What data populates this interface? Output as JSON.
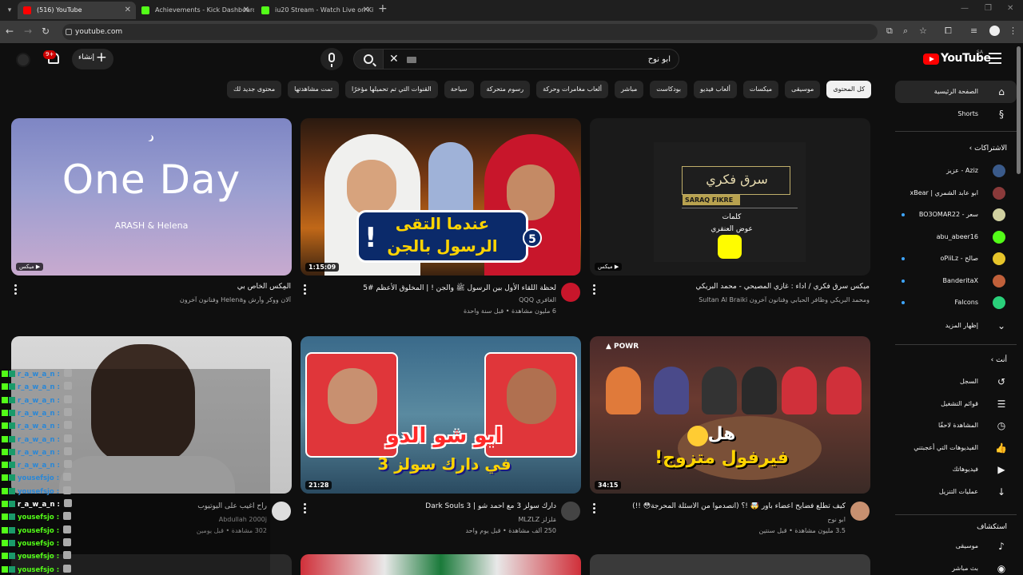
{
  "browser": {
    "tabs": [
      {
        "title": "(516) YouTube",
        "active": true,
        "favicon": "youtube-icon"
      },
      {
        "title": "Achievements - Kick Dashboard",
        "active": false,
        "favicon": "kick-icon"
      },
      {
        "title": "iu20 Stream - Watch Live on Ki",
        "active": false,
        "favicon": "kick-icon"
      }
    ],
    "url": "youtube.com"
  },
  "header": {
    "logo_text": "YouTube",
    "logo_country": "SA",
    "search_query": "ابو نوح",
    "create_label": "إنشاء",
    "notification_count": "9+"
  },
  "chips": [
    "كل المحتوى",
    "موسيقى",
    "ميكسات",
    "ألعاب فيديو",
    "بودكاست",
    "مباشر",
    "ألعاب مغامرات وحركة",
    "رسوم متحركة",
    "سياحة",
    "القنوات التي تم تحميلها مؤخرًا",
    "تمت مشاهدتها",
    "محتوى جديد لك"
  ],
  "sidebar": {
    "home": "الصفحة الرئيسية",
    "shorts": "Shorts",
    "subscriptions_header": "الاشتراكات",
    "subscriptions": [
      {
        "name": "Aziz - عزيز",
        "color": "#3a5a8a",
        "live": false
      },
      {
        "name": "ابو عابد الشمري | xBear",
        "color": "#8a3a3a",
        "live": false
      },
      {
        "name": "سعر - BO3OMAR22",
        "color": "#d0d0a0",
        "live": true
      },
      {
        "name": "abu_abeer16",
        "color": "#53fc18",
        "live": false
      },
      {
        "name": "صالح - oPiiLz",
        "color": "#e6c42a",
        "live": true
      },
      {
        "name": "BanderitaX",
        "color": "#c0603a",
        "live": true
      },
      {
        "name": "Falcons",
        "color": "#2ad07a",
        "live": true
      }
    ],
    "show_more": "إظهار المزيد",
    "you_header": "أنت",
    "you_items": [
      {
        "label": "السجل",
        "icon": "history-icon"
      },
      {
        "label": "قوائم التشغيل",
        "icon": "playlists-icon"
      },
      {
        "label": "المشاهدة لاحقًا",
        "icon": "watch-later-icon"
      },
      {
        "label": "الفيديوهات التي أعجبتني",
        "icon": "like-icon"
      },
      {
        "label": "فيديوهاتك",
        "icon": "your-videos-icon"
      },
      {
        "label": "عمليات التنزيل",
        "icon": "download-icon"
      }
    ],
    "explore_header": "استكشاف",
    "explore_items": [
      {
        "label": "موسيقى",
        "icon": "music-icon"
      },
      {
        "label": "بث مباشر",
        "icon": "live-icon"
      }
    ]
  },
  "videos": [
    {
      "title": "المِكس الخاص بي",
      "meta1": "آلان ووكر وآرش وHelena وفنانون آخرون",
      "meta2": "",
      "badge": "ميكس",
      "thumb_title": "One Day",
      "thumb_sub": "ARASH & Helena"
    },
    {
      "title": "لحظة اللقاء الأول بين الرسول ﷺ والجن ! | المخلوق الأعظم #5",
      "meta1": "الغافري QQQ",
      "meta2": "6 مليون مشاهدة • قبل سنة واحدة",
      "duration": "1:15:09",
      "thumb_line1": "عندما التقى",
      "thumb_line2": "الرسول بالجن",
      "thumb_num": "5"
    },
    {
      "title": "ميكس سرق فكري / اداء : غازي المصيحي - محمد البريكي",
      "meta1": "ومحمد البريكي وظافر الحبابي وفنانون آخرون Sultan Al Braiki",
      "meta2": "",
      "badge": "ميكس",
      "thumb_title": "سرق فكري",
      "thumb_tag": "SARAQ FIKRE",
      "thumb_w1": "كلمات",
      "thumb_w2": "عوض العنقري"
    },
    {
      "title": "راح اغيب على اليوتيوب",
      "meta1": "Abdullah 2000j",
      "meta2": "302 مشاهدة • قبل يومين"
    },
    {
      "title": "دارك سولز 3 مع احمد شو | Dark Souls 3",
      "meta1": "مَلزلز MLZLZ",
      "meta2": "250 ألف مشاهدة • قبل يوم واحد",
      "duration": "21:28",
      "thumb_line1": "ابو شو الدو",
      "thumb_line2": "في دارك سولز 3"
    },
    {
      "title": "كيف تطلع فضايح اعضاء باور 🤯 !؟ (انصدموا من الأسئلة المحرجة😳 !!)",
      "meta1": "ابو نوح",
      "meta2": "3.5 مليون مشاهدة • قبل سنتين",
      "duration": "34:15",
      "thumb_line1": "هل",
      "thumb_line2": "فيرفول متزوج!"
    }
  ],
  "chat": [
    {
      "user": "r_a_w_a_n",
      "style": "u1"
    },
    {
      "user": "r_a_w_a_n",
      "style": "u1"
    },
    {
      "user": "r_a_w_a_n",
      "style": "u1"
    },
    {
      "user": "r_a_w_a_n",
      "style": "u1"
    },
    {
      "user": "r_a_w_a_n",
      "style": "u1"
    },
    {
      "user": "r_a_w_a_n",
      "style": "u1"
    },
    {
      "user": "r_a_w_a_n",
      "style": "u1"
    },
    {
      "user": "r_a_w_a_n",
      "style": "u1"
    },
    {
      "user": "yousefsjo",
      "style": "u1"
    },
    {
      "user": "yousefsjo",
      "style": "u1"
    },
    {
      "user": "r_a_w_a_n",
      "style": "u3"
    },
    {
      "user": "yousefsjo",
      "style": "u2"
    },
    {
      "user": "yousefsjo",
      "style": "u2"
    },
    {
      "user": "yousefsjo",
      "style": "u2"
    },
    {
      "user": "yousefsjo",
      "style": "u2"
    },
    {
      "user": "yousefsjo",
      "style": "u2"
    }
  ],
  "colors": {
    "accent": "#ff0000",
    "kick": "#53fc18",
    "background": "#0f0f0f"
  }
}
